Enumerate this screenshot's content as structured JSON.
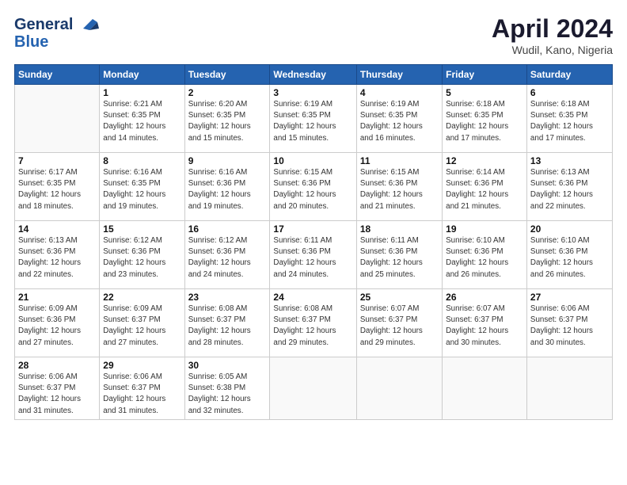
{
  "logo": {
    "line1": "General",
    "line2": "Blue"
  },
  "title": "April 2024",
  "location": "Wudil, Kano, Nigeria",
  "header_days": [
    "Sunday",
    "Monday",
    "Tuesday",
    "Wednesday",
    "Thursday",
    "Friday",
    "Saturday"
  ],
  "weeks": [
    [
      {
        "num": "",
        "info": ""
      },
      {
        "num": "1",
        "info": "Sunrise: 6:21 AM\nSunset: 6:35 PM\nDaylight: 12 hours\nand 14 minutes."
      },
      {
        "num": "2",
        "info": "Sunrise: 6:20 AM\nSunset: 6:35 PM\nDaylight: 12 hours\nand 15 minutes."
      },
      {
        "num": "3",
        "info": "Sunrise: 6:19 AM\nSunset: 6:35 PM\nDaylight: 12 hours\nand 15 minutes."
      },
      {
        "num": "4",
        "info": "Sunrise: 6:19 AM\nSunset: 6:35 PM\nDaylight: 12 hours\nand 16 minutes."
      },
      {
        "num": "5",
        "info": "Sunrise: 6:18 AM\nSunset: 6:35 PM\nDaylight: 12 hours\nand 17 minutes."
      },
      {
        "num": "6",
        "info": "Sunrise: 6:18 AM\nSunset: 6:35 PM\nDaylight: 12 hours\nand 17 minutes."
      }
    ],
    [
      {
        "num": "7",
        "info": "Sunrise: 6:17 AM\nSunset: 6:35 PM\nDaylight: 12 hours\nand 18 minutes."
      },
      {
        "num": "8",
        "info": "Sunrise: 6:16 AM\nSunset: 6:35 PM\nDaylight: 12 hours\nand 19 minutes."
      },
      {
        "num": "9",
        "info": "Sunrise: 6:16 AM\nSunset: 6:36 PM\nDaylight: 12 hours\nand 19 minutes."
      },
      {
        "num": "10",
        "info": "Sunrise: 6:15 AM\nSunset: 6:36 PM\nDaylight: 12 hours\nand 20 minutes."
      },
      {
        "num": "11",
        "info": "Sunrise: 6:15 AM\nSunset: 6:36 PM\nDaylight: 12 hours\nand 21 minutes."
      },
      {
        "num": "12",
        "info": "Sunrise: 6:14 AM\nSunset: 6:36 PM\nDaylight: 12 hours\nand 21 minutes."
      },
      {
        "num": "13",
        "info": "Sunrise: 6:13 AM\nSunset: 6:36 PM\nDaylight: 12 hours\nand 22 minutes."
      }
    ],
    [
      {
        "num": "14",
        "info": "Sunrise: 6:13 AM\nSunset: 6:36 PM\nDaylight: 12 hours\nand 22 minutes."
      },
      {
        "num": "15",
        "info": "Sunrise: 6:12 AM\nSunset: 6:36 PM\nDaylight: 12 hours\nand 23 minutes."
      },
      {
        "num": "16",
        "info": "Sunrise: 6:12 AM\nSunset: 6:36 PM\nDaylight: 12 hours\nand 24 minutes."
      },
      {
        "num": "17",
        "info": "Sunrise: 6:11 AM\nSunset: 6:36 PM\nDaylight: 12 hours\nand 24 minutes."
      },
      {
        "num": "18",
        "info": "Sunrise: 6:11 AM\nSunset: 6:36 PM\nDaylight: 12 hours\nand 25 minutes."
      },
      {
        "num": "19",
        "info": "Sunrise: 6:10 AM\nSunset: 6:36 PM\nDaylight: 12 hours\nand 26 minutes."
      },
      {
        "num": "20",
        "info": "Sunrise: 6:10 AM\nSunset: 6:36 PM\nDaylight: 12 hours\nand 26 minutes."
      }
    ],
    [
      {
        "num": "21",
        "info": "Sunrise: 6:09 AM\nSunset: 6:36 PM\nDaylight: 12 hours\nand 27 minutes."
      },
      {
        "num": "22",
        "info": "Sunrise: 6:09 AM\nSunset: 6:37 PM\nDaylight: 12 hours\nand 27 minutes."
      },
      {
        "num": "23",
        "info": "Sunrise: 6:08 AM\nSunset: 6:37 PM\nDaylight: 12 hours\nand 28 minutes."
      },
      {
        "num": "24",
        "info": "Sunrise: 6:08 AM\nSunset: 6:37 PM\nDaylight: 12 hours\nand 29 minutes."
      },
      {
        "num": "25",
        "info": "Sunrise: 6:07 AM\nSunset: 6:37 PM\nDaylight: 12 hours\nand 29 minutes."
      },
      {
        "num": "26",
        "info": "Sunrise: 6:07 AM\nSunset: 6:37 PM\nDaylight: 12 hours\nand 30 minutes."
      },
      {
        "num": "27",
        "info": "Sunrise: 6:06 AM\nSunset: 6:37 PM\nDaylight: 12 hours\nand 30 minutes."
      }
    ],
    [
      {
        "num": "28",
        "info": "Sunrise: 6:06 AM\nSunset: 6:37 PM\nDaylight: 12 hours\nand 31 minutes."
      },
      {
        "num": "29",
        "info": "Sunrise: 6:06 AM\nSunset: 6:37 PM\nDaylight: 12 hours\nand 31 minutes."
      },
      {
        "num": "30",
        "info": "Sunrise: 6:05 AM\nSunset: 6:38 PM\nDaylight: 12 hours\nand 32 minutes."
      },
      {
        "num": "",
        "info": ""
      },
      {
        "num": "",
        "info": ""
      },
      {
        "num": "",
        "info": ""
      },
      {
        "num": "",
        "info": ""
      }
    ]
  ]
}
